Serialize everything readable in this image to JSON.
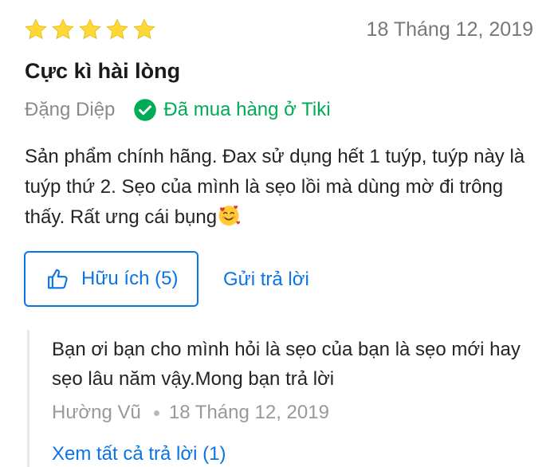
{
  "review": {
    "rating": 5,
    "max_rating": 5,
    "star_color": "#fdd836",
    "date": "18 Tháng 12, 2019",
    "title": "Cực kì hài lòng",
    "author": "Đặng Diệp",
    "verified_label": "Đã mua hàng ở Tiki",
    "verified_icon": "check-circle-icon",
    "verified_color": "#00ab56",
    "body": "Sản phẩm chính hãng. Đax sử dụng hết 1 tuýp, tuýp này là tuýp thứ 2. Sẹo của mình là sẹo lồi mà dùng mờ đi trông thấy. Rất ưng cái bụng",
    "body_emoji": "smiling-face-with-hearts-icon"
  },
  "actions": {
    "helpful_label": "Hữu ích (5)",
    "helpful_icon": "thumbs-up-icon",
    "reply_label": "Gửi trả lời",
    "accent_color": "#0b74e5"
  },
  "reply": {
    "text": "Bạn ơi bạn cho mình hỏi là sẹo của bạn là sẹo mới hay sẹo lâu năm vậy.Mong bạn trả lời",
    "author": "Hường Vũ",
    "date": "18 Tháng 12, 2019",
    "see_all_label": "Xem tất cả trả lời (1)"
  }
}
